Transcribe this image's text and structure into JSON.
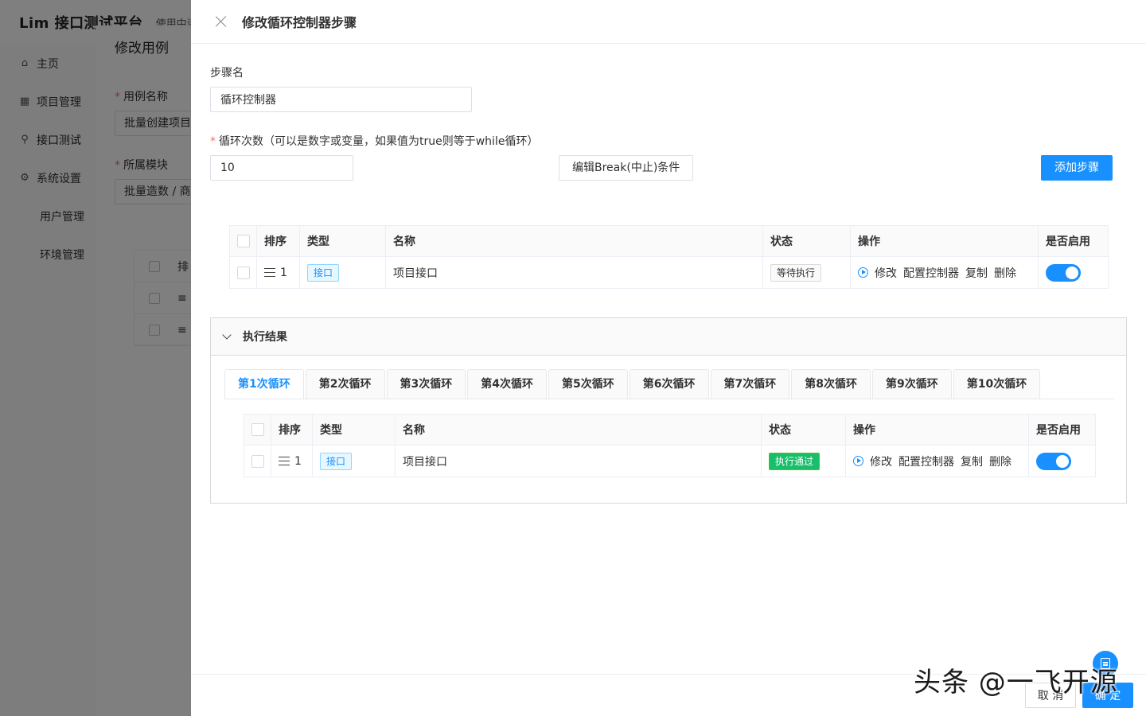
{
  "background": {
    "brand": "Lim 接口测试平台",
    "user_text": "使用中课",
    "menu": [
      {
        "label": "主页",
        "icon": "home-icon"
      },
      {
        "label": "项目管理",
        "icon": "project-icon"
      },
      {
        "label": "接口测试",
        "icon": "link-icon"
      },
      {
        "label": "系统设置",
        "icon": "gear-icon"
      },
      {
        "label": "用户管理"
      },
      {
        "label": "环境管理"
      }
    ],
    "dialog": {
      "title": "修改用例",
      "case_name_label": "用例名称",
      "case_name_value": "批量创建项目",
      "module_label": "所属模块",
      "module_value": "批量造数 / 商品",
      "table_header_sort": "排"
    }
  },
  "drawer": {
    "title": "修改循环控制器步骤",
    "step_name_label": "步骤名",
    "step_name_value": "循环控制器",
    "loop_count_label": "循环次数（可以是数字或变量，如果值为true则等于while循环）",
    "loop_count_value": "10",
    "edit_break_button": "编辑Break(中止)条件",
    "add_step_button": "添加步骤",
    "table": {
      "headers": [
        "排序",
        "类型",
        "名称",
        "状态",
        "操作",
        "是否启用"
      ],
      "rows": [
        {
          "sort": "1",
          "type": "接口",
          "name": "项目接口",
          "status": "等待执行",
          "enabled": true
        }
      ],
      "actions": [
        "修改",
        "配置控制器",
        "复制",
        "删除"
      ]
    },
    "result": {
      "title": "执行结果",
      "tabs": [
        "第1次循环",
        "第2次循环",
        "第3次循环",
        "第4次循环",
        "第5次循环",
        "第6次循环",
        "第7次循环",
        "第8次循环",
        "第9次循环",
        "第10次循环"
      ],
      "active_tab": 0,
      "table": {
        "headers": [
          "排序",
          "类型",
          "名称",
          "状态",
          "操作",
          "是否启用"
        ],
        "rows": [
          {
            "sort": "1",
            "type": "接口",
            "name": "项目接口",
            "status": "执行通过",
            "enabled": true
          }
        ],
        "actions": [
          "修改",
          "配置控制器",
          "复制",
          "删除"
        ]
      }
    },
    "footer": {
      "cancel": "取 消",
      "ok": "确 定"
    }
  },
  "watermark": "头条 @一飞开源",
  "colors": {
    "primary": "#1890ff",
    "success": "#19be6b",
    "required": "#f56c6c"
  }
}
